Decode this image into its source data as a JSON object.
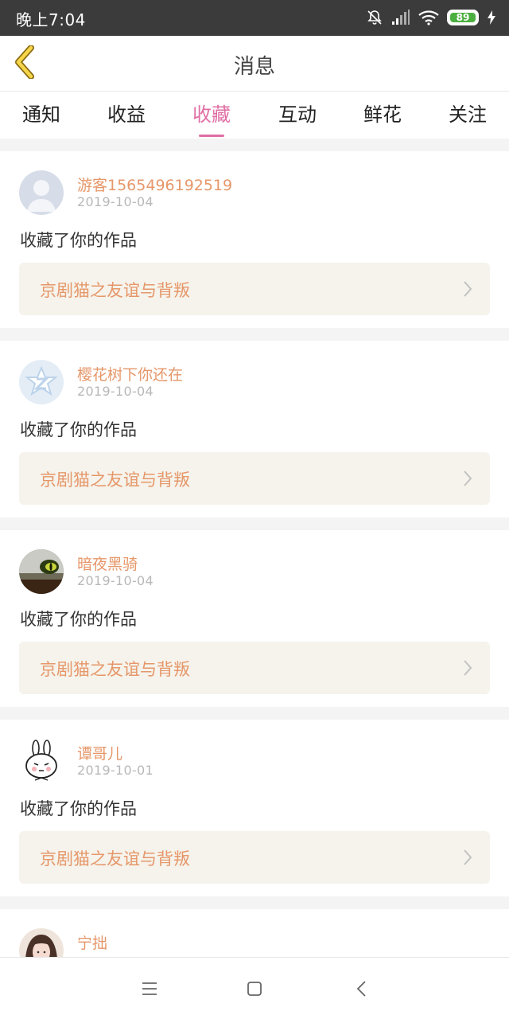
{
  "status_bar": {
    "time": "晚上7:04",
    "battery": "89",
    "icons": [
      "bell-muted-icon",
      "signal-icon",
      "wifi-icon",
      "battery-icon",
      "charging-icon"
    ]
  },
  "header": {
    "title": "消息",
    "back_icon": "chevron-left-icon"
  },
  "tabs": [
    {
      "label": "通知",
      "active": false
    },
    {
      "label": "收益",
      "active": false
    },
    {
      "label": "收藏",
      "active": true
    },
    {
      "label": "互动",
      "active": false
    },
    {
      "label": "鲜花",
      "active": false
    },
    {
      "label": "关注",
      "active": false
    }
  ],
  "items": [
    {
      "name": "游客1565496192519",
      "date": "2019-10-04",
      "action": "收藏了你的作品",
      "work": "京剧猫之友谊与背叛",
      "avatar": "default-avatar"
    },
    {
      "name": "樱花树下你还在",
      "date": "2019-10-04",
      "action": "收藏了你的作品",
      "work": "京剧猫之友谊与背叛",
      "avatar": "qq-avatar"
    },
    {
      "name": "暗夜黑骑",
      "date": "2019-10-04",
      "action": "收藏了你的作品",
      "work": "京剧猫之友谊与背叛",
      "avatar": "cat-eye-avatar"
    },
    {
      "name": "谭哥儿",
      "date": "2019-10-01",
      "action": "收藏了你的作品",
      "work": "京剧猫之友谊与背叛",
      "avatar": "rabbit-avatar"
    },
    {
      "name": "宁拙",
      "date": "",
      "action": "",
      "work": "",
      "avatar": "girl-avatar"
    }
  ],
  "colors": {
    "accent": "#e06ea4",
    "name": "#e6976a",
    "work_bg": "#f5f3eb",
    "separator": "#f4f4f4"
  },
  "nav_bar": {
    "icons": [
      "menu-icon",
      "home-square-icon",
      "back-triangle-icon"
    ]
  }
}
